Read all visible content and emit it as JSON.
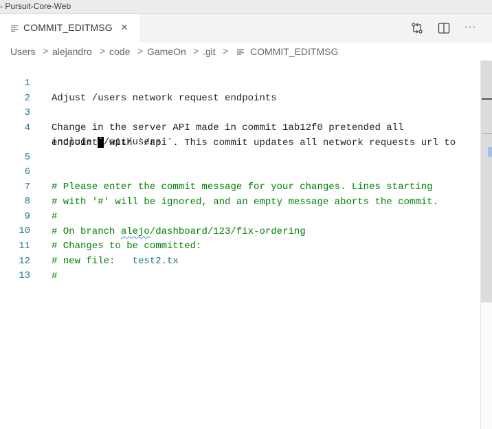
{
  "window": {
    "title": "- Pursuit-Core-Web"
  },
  "tab": {
    "label": "COMMIT_EDITMSG",
    "close": "×"
  },
  "actions": {
    "compare_icon": "git-compare-icon",
    "split_icon": "split-editor-icon",
    "more_icon": "more-actions-icon",
    "more_glyph": "···"
  },
  "breadcrumb": {
    "items": [
      "Users",
      "alejandro",
      "code",
      "GameOn",
      ".git",
      "COMMIT_EDITMSG"
    ],
    "separator": ">"
  },
  "editor": {
    "lines": [
      {
        "n": "1",
        "text": "Adjust /users network request endpoints"
      },
      {
        "n": "2",
        "text": ""
      },
      {
        "n": "3",
        "text": "Change in the server API made in commit 1ab12f0 pretended all"
      },
      {
        "n": "4",
        "text": "endpoints with `/api`. This commit updates all network requests url to"
      },
      {
        "n": "",
        "pre": "include ",
        "cursor": "`",
        "post": "/api/users`"
      },
      {
        "n": "5",
        "text": ""
      },
      {
        "n": "6",
        "text": "# Please enter the commit message for your changes. Lines starting"
      },
      {
        "n": "7",
        "text": "# with '#' will be ignored, and an empty message aborts the commit."
      },
      {
        "n": "8",
        "text": "#"
      },
      {
        "n": "9",
        "pre": "# On branch ",
        "squiggle": "alejo",
        "post": "/dashboard/123/fix-ordering"
      },
      {
        "n": "10",
        "text": "# Changes to be committed:"
      },
      {
        "n": "11",
        "pre": "# new file:   ",
        "path": "test2.tx"
      },
      {
        "n": "12",
        "text": "#"
      },
      {
        "n": "13",
        "text": ""
      }
    ]
  }
}
